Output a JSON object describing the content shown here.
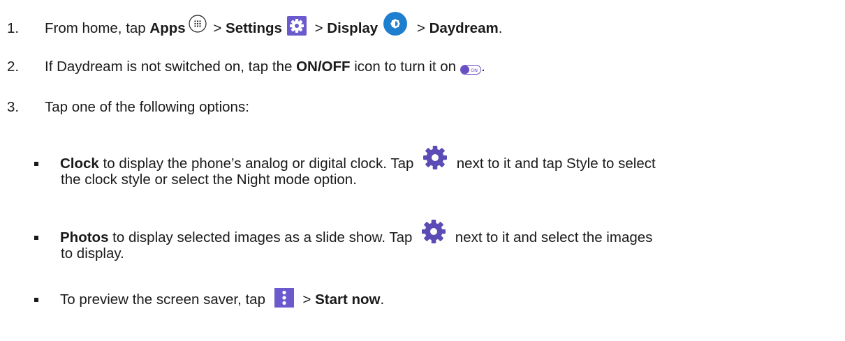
{
  "step1": {
    "number": "1.",
    "text_a": "From home, tap ",
    "apps": "Apps",
    "sep1": " > ",
    "settings": "Settings",
    "sep2": " > ",
    "display": "Display",
    "sep3": " > ",
    "daydream": "Daydream",
    "end": "."
  },
  "step2": {
    "number": "2.",
    "text_a": "If Daydream is not switched on, tap the ",
    "onoff": "ON/OFF",
    "text_b": " icon to turn it on",
    "end": ".",
    "toggle_label": "ON"
  },
  "step3": {
    "number": "3.",
    "text": "Tap one of the following options:"
  },
  "bullets": {
    "clock": {
      "bold": "Clock",
      "text_a": " to display the phone’s analog or digital clock. Tap ",
      "text_b": " next to it and tap Style to select",
      "line2": "the clock style or select the Night mode option."
    },
    "photos": {
      "bold": "Photos",
      "text_a": " to display selected images as a slide show. Tap ",
      "text_b": " next to it and select the images",
      "line2": "to display."
    },
    "preview": {
      "text_a": "To preview the screen saver, tap ",
      "sep": " > ",
      "bold": "Start now",
      "end": "."
    }
  },
  "colors": {
    "text": "#1a1a1a",
    "settings_icon_bg": "#6a5acd",
    "display_icon_bg": "#1f7fcf",
    "gear_purple": "#5b4bb5",
    "menu_icon_bg": "#6a5acd",
    "toggle_purple": "#6a4fc2"
  }
}
